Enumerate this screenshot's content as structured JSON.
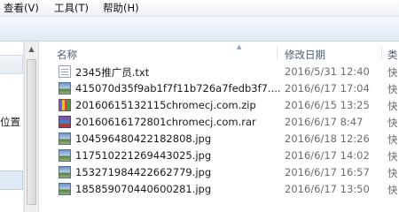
{
  "menubar": {
    "view": "查看(V)",
    "tools": "工具(T)",
    "help": "帮助(H)"
  },
  "nav": {
    "location_label": "位置"
  },
  "columns": {
    "name": "名称",
    "modified": "修改日期",
    "type": "类"
  },
  "files": [
    {
      "name": "2345推广员.txt",
      "date": "2016/5/31 12:40",
      "type": "快",
      "icon": "text-file-icon"
    },
    {
      "name": "415070d35f9ab1f7f11b726a7fedb3f7....",
      "date": "2016/6/17 17:04",
      "type": "快",
      "icon": "image-file-icon"
    },
    {
      "name": "20160615132115chromecj.com.zip",
      "date": "2016/6/15 13:25",
      "type": "快",
      "icon": "zip-file-icon"
    },
    {
      "name": "20160616172801chromecj.com.rar",
      "date": "2016/6/17 8:47",
      "type": "快",
      "icon": "rar-file-icon"
    },
    {
      "name": "104596480422182808.jpg",
      "date": "2016/6/18 12:26",
      "type": "快",
      "icon": "image-file-icon"
    },
    {
      "name": "117510221269443025.jpg",
      "date": "2016/6/17 14:02",
      "type": "快",
      "icon": "image-file-icon"
    },
    {
      "name": "153271984422662779.jpg",
      "date": "2016/6/17 16:57",
      "type": "快",
      "icon": "image-file-icon"
    },
    {
      "name": "185859070440600281.jpg",
      "date": "2016/6/17 13:50",
      "type": "快",
      "icon": "image-file-icon"
    }
  ]
}
